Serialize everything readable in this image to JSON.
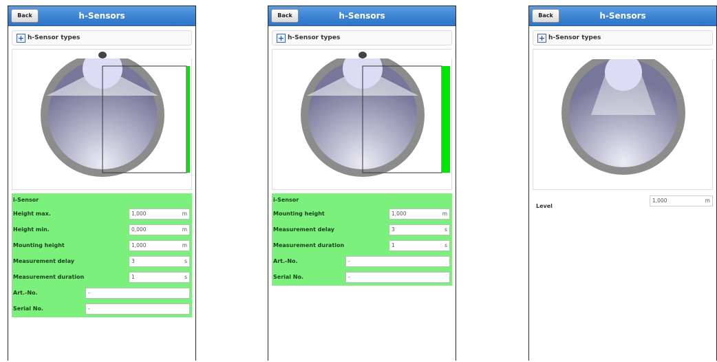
{
  "screens": [
    {
      "header": {
        "back_label": "Back",
        "title": "h-Sensors"
      },
      "accordion": {
        "label": "h-Sensor types"
      },
      "visualization": {
        "show_range_box": true,
        "range_bar_color": "#00e600"
      },
      "panel": {
        "heading": "i-Sensor",
        "fields": [
          {
            "label": "Height max.",
            "value": "1,000",
            "unit": "m"
          },
          {
            "label": "Height min.",
            "value": "0,000",
            "unit": "m"
          },
          {
            "label": "Mounting height",
            "value": "1,000",
            "unit": "m"
          },
          {
            "label": "Measurement delay",
            "value": "3",
            "unit": "s"
          },
          {
            "label": "Measurement duration",
            "value": "1",
            "unit": "s"
          },
          {
            "label": "Art.-No.",
            "value": "-",
            "unit": ""
          },
          {
            "label": "Serial No.",
            "value": "-",
            "unit": ""
          }
        ]
      }
    },
    {
      "header": {
        "back_label": "Back",
        "title": "h-Sensors"
      },
      "accordion": {
        "label": "h-Sensor types"
      },
      "visualization": {
        "show_range_box": true,
        "range_bar_color": "#00e600"
      },
      "panel": {
        "heading": "i-Sensor",
        "fields": [
          {
            "label": "Mounting height",
            "value": "1,000",
            "unit": "m"
          },
          {
            "label": "Measurement delay",
            "value": "3",
            "unit": "s"
          },
          {
            "label": "Measurement duration",
            "value": "1",
            "unit": "s"
          },
          {
            "label": "Art.-No.",
            "value": "-",
            "unit": ""
          },
          {
            "label": "Serial No.",
            "value": "-",
            "unit": ""
          }
        ]
      }
    },
    {
      "header": {
        "back_label": "Back",
        "title": "h-Sensors"
      },
      "accordion": {
        "label": "h-Sensor types"
      },
      "visualization": {
        "show_range_box": false
      },
      "level": {
        "label": "Level",
        "value": "1,000",
        "unit": "m"
      }
    }
  ],
  "colors": {
    "header_blue": "#3d83d3",
    "panel_green": "#7cf07c",
    "range_green": "#00e600",
    "pipe_gray": "#8c8c8c"
  }
}
